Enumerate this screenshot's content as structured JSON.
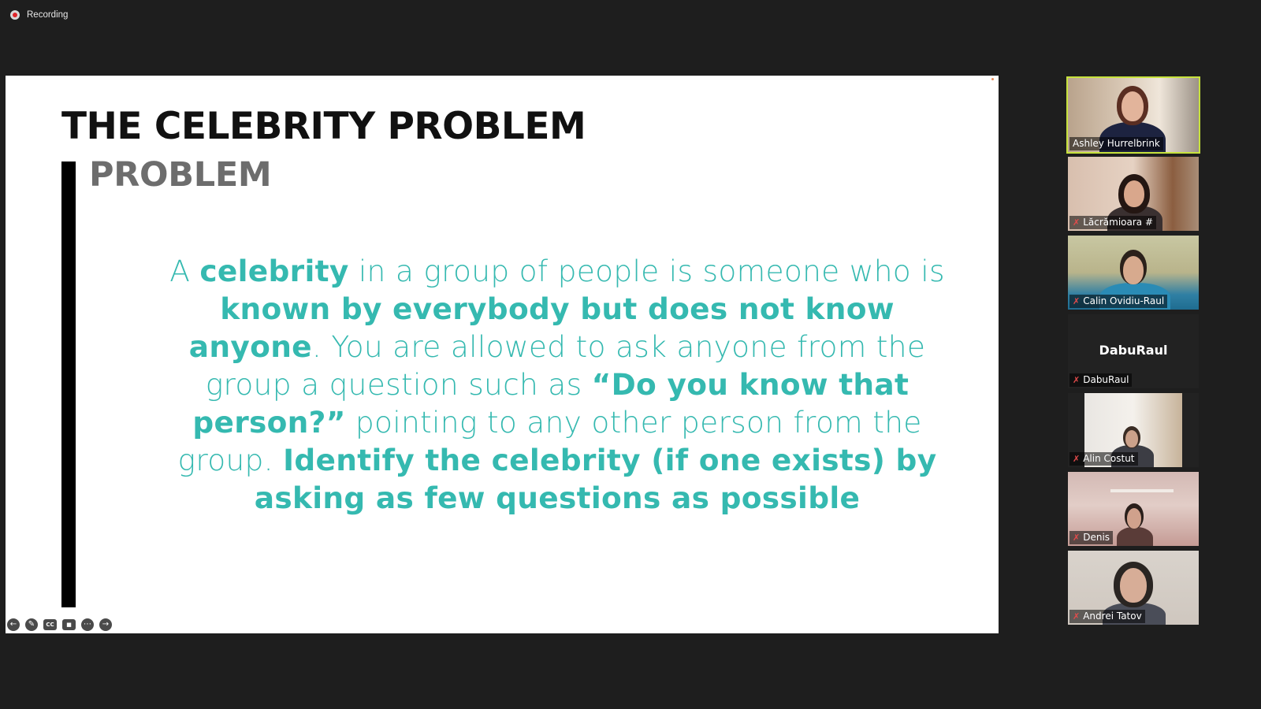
{
  "recording": {
    "label": "Recording"
  },
  "slide": {
    "title": "THE CELEBRITY PROBLEM",
    "subtitle": "PROBLEM",
    "body": {
      "t1": "A ",
      "t2": "celebrity",
      "t3": " in a group of people is someone who is ",
      "t4": "known by everybody but does not know anyone",
      "t5": ". You are allowed to ask anyone from the group a question such as ",
      "t6": "“Do you know that person?”",
      "t7": " pointing to any other person from the group. ",
      "t8": "Identify the celebrity (if one exists) by asking as few questions as possible"
    },
    "colors": {
      "title": "#111111",
      "subtitle": "#6d6d6d",
      "body": "#35b9b0"
    },
    "controls": [
      "arrow-left-icon",
      "pencil-icon",
      "cc-icon",
      "video-off-icon",
      "more-icon",
      "arrow-right-icon"
    ]
  },
  "participants": [
    {
      "name": "Ashley Hurrelbrink",
      "muted": false,
      "active": true
    },
    {
      "name": "Lăcrămioara #",
      "muted": true,
      "active": false
    },
    {
      "name": "Calin Ovidiu-Raul",
      "muted": true,
      "active": false
    },
    {
      "name": "DabuRaul",
      "muted": true,
      "active": false,
      "no_video_label": "DabuRaul"
    },
    {
      "name": "Alin Costut",
      "muted": true,
      "active": false
    },
    {
      "name": "Denis",
      "muted": true,
      "active": false
    },
    {
      "name": "Andrei Tatov",
      "muted": true,
      "active": false
    }
  ],
  "accent_color": "#c7e23d"
}
